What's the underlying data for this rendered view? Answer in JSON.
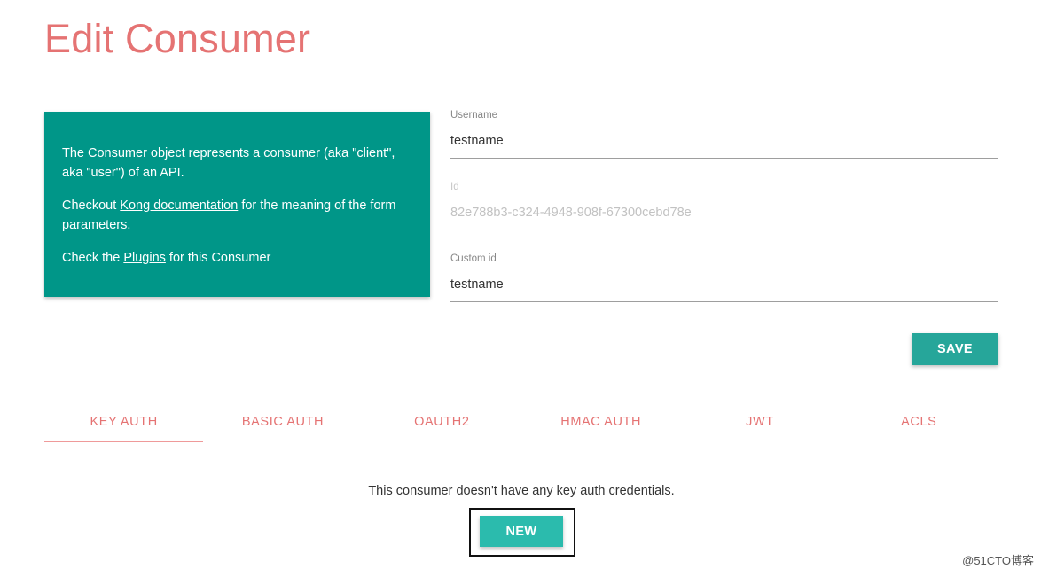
{
  "page": {
    "title": "Edit Consumer"
  },
  "info_card": {
    "line1": "The Consumer object represents a consumer (aka \"client\", aka \"user\") of an API.",
    "line2_prefix": "Checkout ",
    "line2_link": "Kong documentation",
    "line2_suffix": " for the meaning of the form parameters.",
    "line3_prefix": "Check the ",
    "line3_link": "Plugins",
    "line3_suffix": " for this Consumer"
  },
  "form": {
    "username": {
      "label": "Username",
      "value": "testname"
    },
    "id": {
      "label": "Id",
      "value": "82e788b3-c324-4948-908f-67300cebd78e"
    },
    "custom_id": {
      "label": "Custom id",
      "value": "testname"
    },
    "save_label": "SAVE"
  },
  "tabs": [
    {
      "label": "KEY AUTH",
      "active": true
    },
    {
      "label": "BASIC AUTH",
      "active": false
    },
    {
      "label": "OAUTH2",
      "active": false
    },
    {
      "label": "HMAC AUTH",
      "active": false
    },
    {
      "label": "JWT",
      "active": false
    },
    {
      "label": "ACLS",
      "active": false
    }
  ],
  "credentials": {
    "empty_message": "This consumer doesn't have any key auth credentials.",
    "new_label": "NEW"
  },
  "watermark": "@51CTO博客",
  "colors": {
    "title": "#e57373",
    "card_bg": "#009688",
    "save_button": "#26a69a",
    "new_button": "#2bbbad",
    "tab_text": "#e57373",
    "tab_indicator": "#ef9a9a"
  }
}
